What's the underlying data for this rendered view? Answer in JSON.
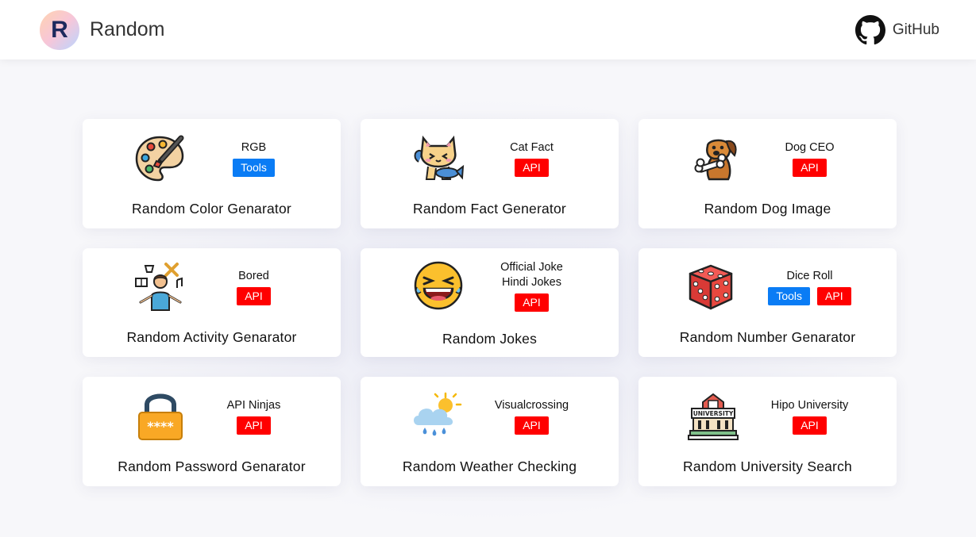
{
  "navbar": {
    "logo_letter": "R",
    "brand_name": "Random",
    "github_label": "GitHub"
  },
  "colors": {
    "tools_badge": "#0a7cf5",
    "api_badge": "#ff0000"
  },
  "cards": [
    {
      "title": "Random Color Genarator",
      "source_lines": [
        "RGB"
      ],
      "badges": [
        "Tools"
      ],
      "icon": "palette-icon"
    },
    {
      "title": "Random Fact Generator",
      "source_lines": [
        "Cat Fact"
      ],
      "badges": [
        "API"
      ],
      "icon": "cat-icon"
    },
    {
      "title": "Random Dog Image",
      "source_lines": [
        "Dog CEO"
      ],
      "badges": [
        "API"
      ],
      "icon": "dog-icon"
    },
    {
      "title": "Random Activity Genarator",
      "source_lines": [
        "Bored"
      ],
      "badges": [
        "API"
      ],
      "icon": "activity-person-icon"
    },
    {
      "title": "Random Jokes",
      "source_lines": [
        "Official Joke",
        "Hindi Jokes"
      ],
      "badges": [
        "API"
      ],
      "icon": "laughing-emoji-icon"
    },
    {
      "title": "Random Number Genarator",
      "source_lines": [
        "Dice Roll"
      ],
      "badges": [
        "Tools",
        "API"
      ],
      "icon": "dice-icon"
    },
    {
      "title": "Random Password Genarator",
      "source_lines": [
        "API Ninjas"
      ],
      "badges": [
        "API"
      ],
      "icon": "padlock-icon"
    },
    {
      "title": "Random Weather Checking",
      "source_lines": [
        "Visualcrossing"
      ],
      "badges": [
        "API"
      ],
      "icon": "weather-cloud-icon"
    },
    {
      "title": "Random University Search",
      "source_lines": [
        "Hipo University"
      ],
      "badges": [
        "API"
      ],
      "icon": "university-icon",
      "icon_text": "UNIVERSITY"
    }
  ]
}
